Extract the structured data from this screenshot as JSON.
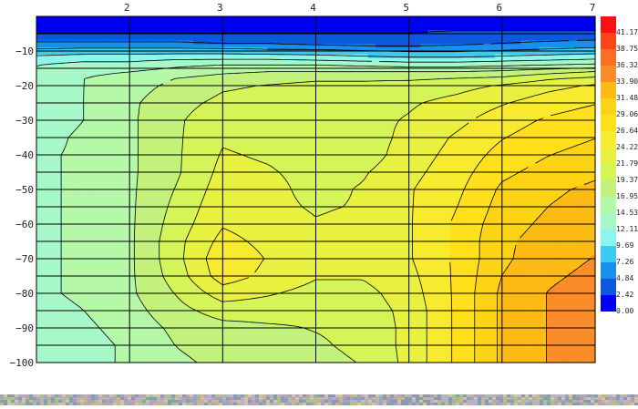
{
  "chart_data": {
    "type": "heatmap",
    "title": "",
    "xlabel": "",
    "ylabel": "",
    "xlim": [
      1,
      7
    ],
    "ylim": [
      -100,
      0
    ],
    "x_ticks": [
      2,
      3,
      4,
      5,
      6,
      7
    ],
    "y_ticks": [
      -10,
      -20,
      -30,
      -40,
      -50,
      -60,
      -70,
      -80,
      -90,
      -100
    ],
    "x_tick_labels": [
      "2",
      "3",
      "4",
      "5",
      "6",
      "7"
    ],
    "y_tick_labels": [
      "−10",
      "−20",
      "−30",
      "−40",
      "−50",
      "−60",
      "−70",
      "−80",
      "−90",
      "−100"
    ],
    "grid": true,
    "contour_levels": [
      0.0,
      2.42,
      4.84,
      7.26,
      9.69,
      12.11,
      14.53,
      16.95,
      19.37,
      21.79,
      24.22,
      26.64,
      29.06,
      31.48,
      33.9,
      36.32,
      38.75,
      41.17
    ],
    "colorbar": {
      "placement": "right",
      "labels": [
        "41.17",
        "38.75",
        "36.32",
        "33.90",
        "31.48",
        "29.06",
        "26.64",
        "24.22",
        "21.79",
        "19.37",
        "16.95",
        "14.53",
        "12.11",
        "9.69",
        "7.26",
        "4.84",
        "2.42",
        "0.00"
      ],
      "colors": [
        "#ff1010",
        "#ff4418",
        "#ff6c28",
        "#fb8c2a",
        "#fdbb14",
        "#fdd415",
        "#ffe01a",
        "#f8ea2e",
        "#e8f040",
        "#d4f458",
        "#c2f27c",
        "#b4f8a8",
        "#a6f8c8",
        "#8cf6ec",
        "#3ccaf4",
        "#1690ec",
        "#0e58de",
        "#0000f0"
      ]
    },
    "x": [
      1,
      1.5,
      2,
      2.5,
      3,
      3.5,
      4,
      4.5,
      5,
      5.5,
      6,
      6.5,
      7
    ],
    "y": [
      -2,
      -5,
      -8,
      -10,
      -12,
      -14,
      -16,
      -18,
      -20,
      -25,
      -30,
      -35,
      -40,
      -45,
      -50,
      -55,
      -60,
      -65,
      -70,
      -75,
      -80,
      -85,
      -90,
      -95,
      -100
    ],
    "z": [
      [
        1.0,
        1.0,
        1.0,
        1.0,
        1.0,
        1.0,
        1.0,
        1.0,
        1.0,
        1.0,
        1.0,
        1.0,
        1.0
      ],
      [
        2.5,
        2.5,
        2.5,
        2.5,
        2.5,
        2.5,
        2.5,
        2.5,
        2.5,
        3.0,
        3.0,
        3.0,
        3.0
      ],
      [
        5.5,
        5.5,
        5.5,
        5.5,
        5.0,
        5.0,
        4.5,
        4.0,
        4.0,
        4.5,
        5.0,
        5.5,
        6.0
      ],
      [
        8.0,
        8.5,
        8.5,
        8.5,
        8.5,
        8.0,
        8.0,
        7.5,
        7.0,
        7.0,
        7.5,
        8.0,
        8.5
      ],
      [
        10.5,
        11.0,
        11.0,
        11.5,
        11.5,
        11.5,
        11.0,
        10.5,
        10.0,
        10.0,
        10.5,
        11.0,
        11.5
      ],
      [
        12.0,
        13.0,
        13.0,
        14.0,
        14.5,
        14.5,
        14.5,
        14.0,
        13.5,
        13.5,
        14.0,
        14.5,
        15.0
      ],
      [
        12.5,
        14.0,
        14.5,
        15.5,
        16.5,
        17.0,
        17.0,
        17.0,
        17.0,
        17.0,
        17.5,
        18.5,
        19.5
      ],
      [
        13.0,
        14.5,
        15.5,
        17.0,
        18.0,
        18.5,
        19.0,
        19.0,
        19.0,
        19.5,
        20.0,
        21.5,
        22.5
      ],
      [
        13.0,
        14.5,
        16.0,
        17.5,
        19.0,
        19.5,
        20.0,
        20.0,
        20.5,
        21.0,
        22.0,
        23.5,
        24.5
      ],
      [
        13.0,
        14.5,
        16.5,
        18.5,
        20.0,
        20.5,
        20.5,
        21.0,
        21.5,
        22.5,
        24.0,
        25.5,
        26.5
      ],
      [
        13.0,
        14.5,
        16.5,
        19.0,
        21.0,
        21.0,
        20.5,
        21.0,
        22.0,
        23.5,
        25.5,
        27.0,
        28.0
      ],
      [
        13.5,
        15.0,
        16.5,
        19.0,
        21.5,
        21.0,
        20.5,
        20.5,
        22.5,
        24.5,
        26.5,
        28.0,
        29.0
      ],
      [
        14.0,
        15.0,
        16.5,
        19.0,
        22.0,
        21.5,
        20.5,
        20.5,
        23.0,
        25.0,
        27.5,
        29.0,
        30.0
      ],
      [
        14.0,
        15.0,
        16.5,
        19.0,
        22.5,
        22.0,
        21.0,
        21.5,
        23.5,
        25.5,
        28.5,
        30.0,
        31.0
      ],
      [
        14.0,
        15.0,
        16.5,
        19.5,
        23.0,
        22.5,
        21.0,
        22.0,
        24.0,
        26.0,
        29.5,
        31.0,
        32.0
      ],
      [
        14.0,
        15.0,
        16.5,
        20.0,
        23.5,
        22.5,
        21.5,
        22.0,
        24.0,
        26.5,
        30.0,
        31.5,
        32.5
      ],
      [
        14.0,
        15.0,
        16.5,
        20.5,
        24.0,
        23.0,
        22.0,
        22.5,
        24.0,
        27.0,
        30.5,
        32.0,
        33.0
      ],
      [
        14.0,
        15.0,
        16.5,
        21.0,
        25.0,
        23.5,
        23.0,
        22.5,
        24.0,
        27.0,
        31.0,
        32.5,
        33.5
      ],
      [
        14.0,
        15.0,
        16.5,
        21.0,
        26.0,
        24.0,
        22.5,
        22.5,
        24.0,
        27.0,
        31.0,
        33.0,
        34.0
      ],
      [
        14.0,
        15.0,
        16.5,
        20.5,
        25.5,
        23.5,
        22.0,
        22.0,
        23.5,
        27.0,
        31.5,
        33.5,
        34.5
      ],
      [
        14.0,
        15.0,
        16.5,
        19.5,
        23.0,
        22.0,
        21.0,
        21.0,
        23.0,
        27.0,
        32.0,
        34.0,
        35.0
      ],
      [
        13.5,
        14.5,
        16.0,
        18.5,
        20.5,
        20.5,
        20.0,
        20.5,
        22.5,
        27.0,
        32.0,
        34.0,
        35.0
      ],
      [
        13.0,
        14.0,
        15.5,
        17.5,
        18.5,
        19.0,
        19.5,
        20.0,
        22.5,
        27.0,
        32.0,
        34.0,
        35.0
      ],
      [
        12.5,
        13.5,
        15.0,
        17.0,
        18.0,
        18.5,
        19.0,
        20.0,
        22.5,
        27.0,
        32.0,
        34.0,
        35.0
      ],
      [
        12.5,
        13.5,
        15.0,
        16.5,
        17.5,
        18.0,
        18.5,
        19.5,
        22.5,
        27.0,
        32.0,
        34.0,
        35.0
      ]
    ]
  }
}
